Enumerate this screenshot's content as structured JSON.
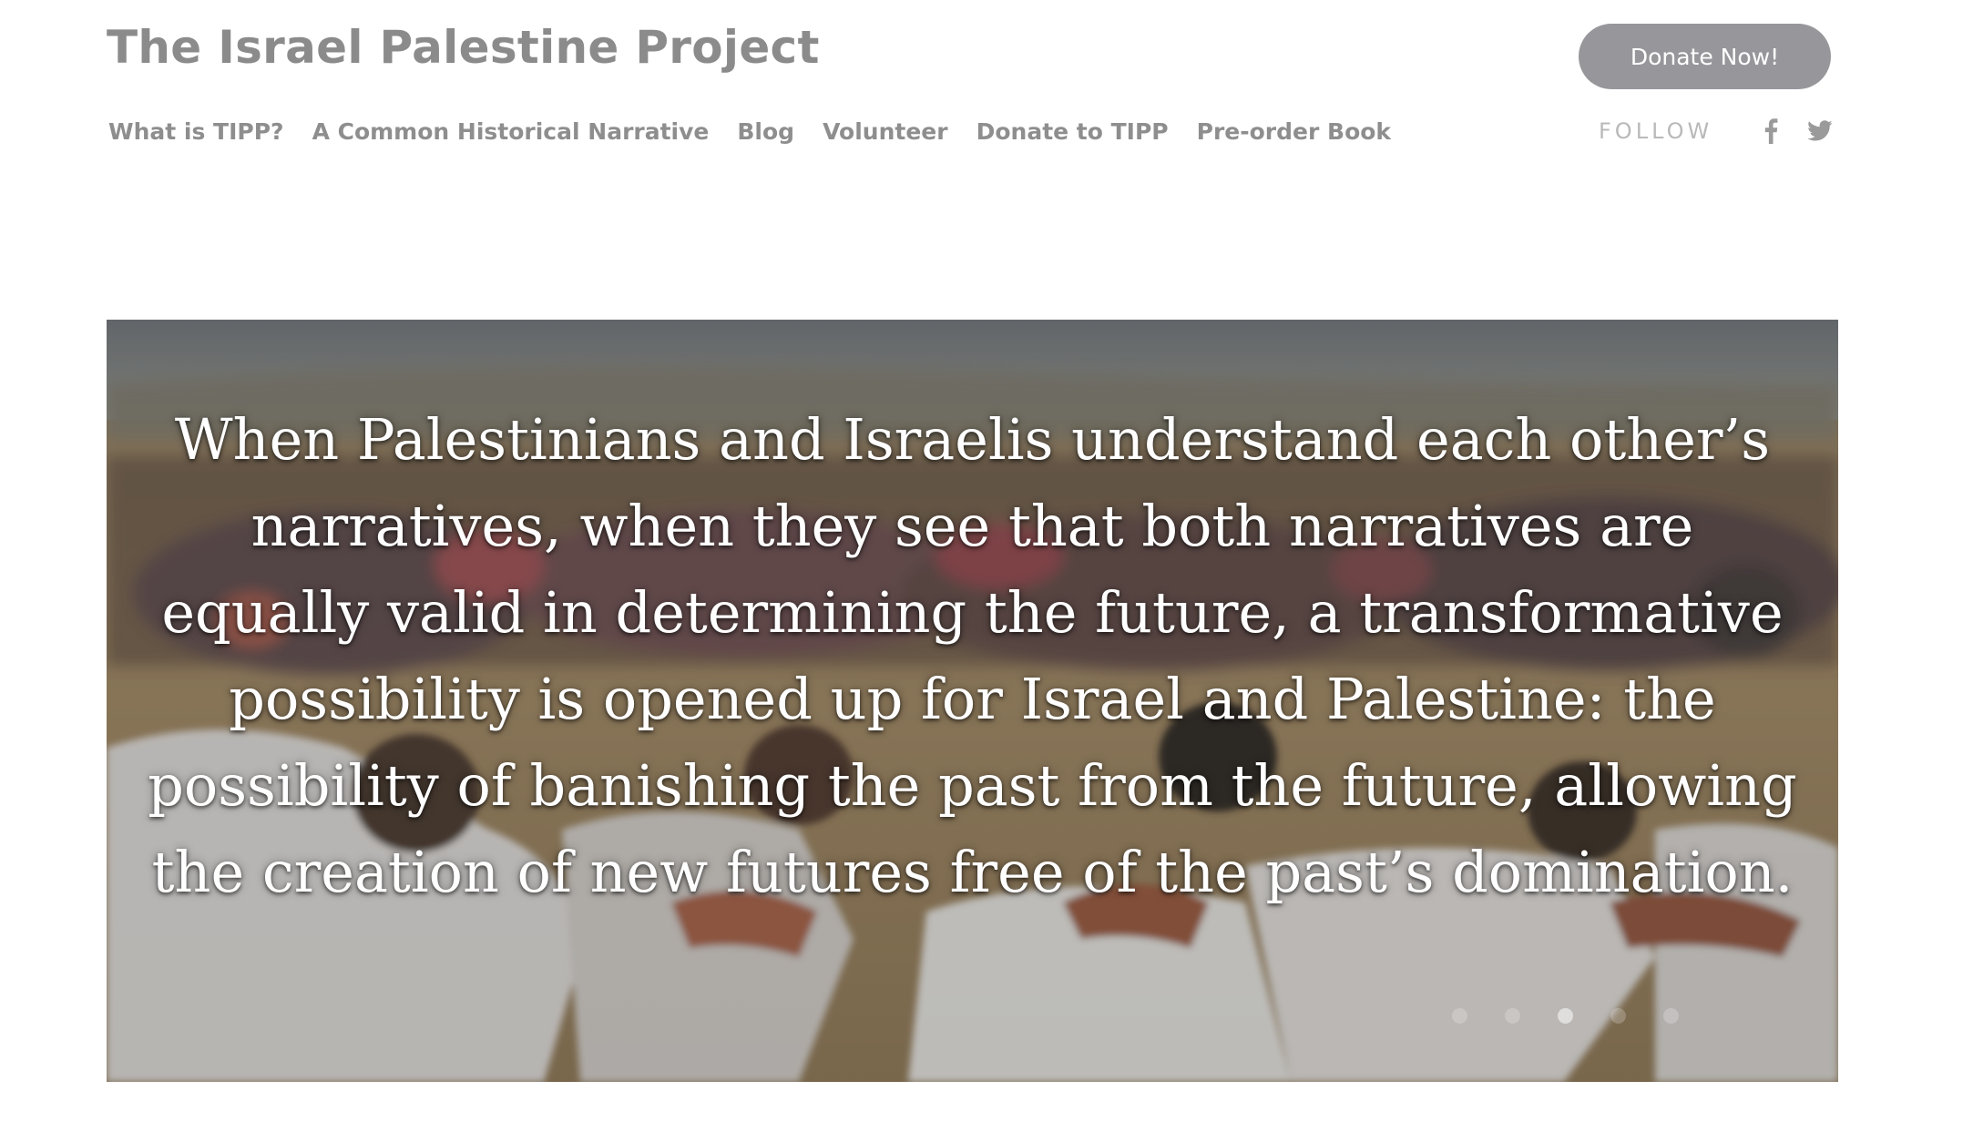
{
  "header": {
    "site_title": "The Israel Palestine Project",
    "donate_label": "Donate Now!"
  },
  "nav": {
    "items": [
      {
        "label": "What is TIPP?"
      },
      {
        "label": "A Common Historical Narrative"
      },
      {
        "label": "Blog"
      },
      {
        "label": "Volunteer"
      },
      {
        "label": "Donate to TIPP"
      },
      {
        "label": "Pre-order Book"
      }
    ]
  },
  "social": {
    "follow_label": "FOLLOW",
    "icons": [
      "facebook-icon",
      "twitter-icon"
    ]
  },
  "hero": {
    "quote": "When Palestinians and Israelis understand each other’s narratives, when they see that both narratives are equally valid in determining the future, a transformative possibility is opened up for Israel and Palestine: the possibility of banishing the past from the future, allowing the creation of new futures free of the past’s domination.",
    "slide_count": 5,
    "active_slide": 3
  },
  "colors": {
    "title": "#8b8b8b",
    "nav_text": "#8e8e8e",
    "donate_button": "#97969b",
    "follow_text": "#b9b9b9",
    "icon": "#9a9a9a"
  }
}
